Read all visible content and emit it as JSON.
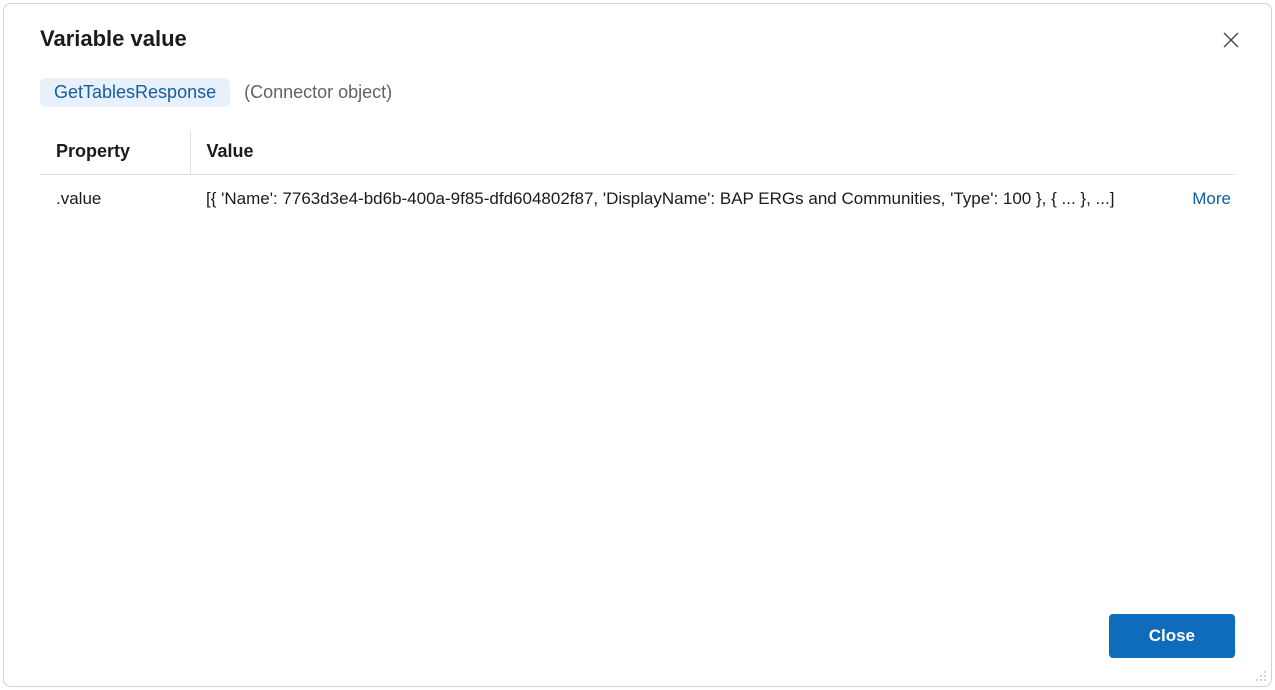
{
  "dialog": {
    "title": "Variable value",
    "chip_label": "GetTablesResponse",
    "type_description": "(Connector object)",
    "close_button_label": "Close"
  },
  "table": {
    "headers": {
      "property": "Property",
      "value": "Value"
    },
    "rows": [
      {
        "property": ".value",
        "value": "[{ 'Name': 7763d3e4-bd6b-400a-9f85-dfd604802f87, 'DisplayName': BAP ERGs and Communities, 'Type': 100 }, {  ... },  ...]",
        "more_label": "More"
      }
    ]
  }
}
